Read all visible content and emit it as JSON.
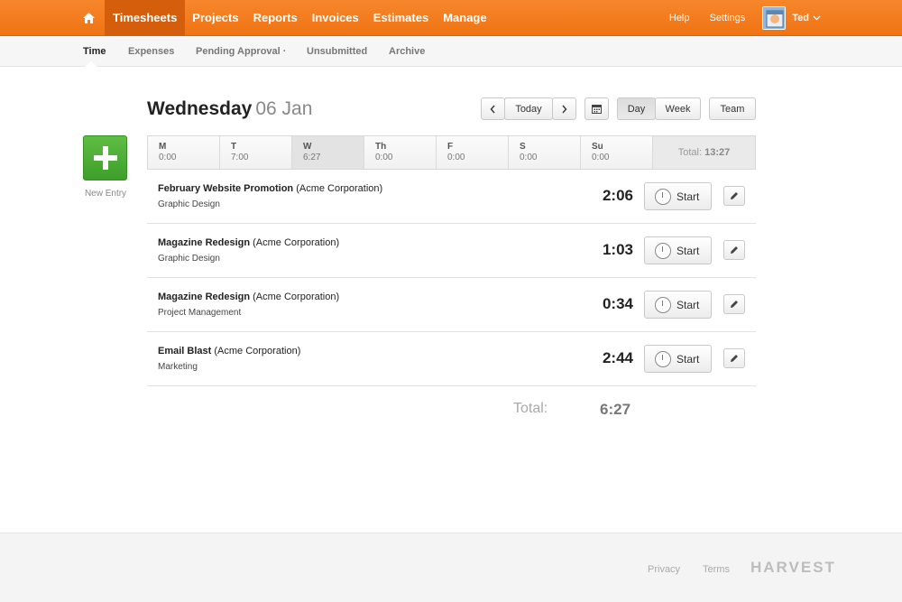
{
  "nav": {
    "items": [
      {
        "label": "Timesheets",
        "active": true
      },
      {
        "label": "Projects"
      },
      {
        "label": "Reports"
      },
      {
        "label": "Invoices"
      },
      {
        "label": "Estimates"
      },
      {
        "label": "Manage"
      }
    ],
    "help": "Help",
    "settings": "Settings",
    "user": "Ted",
    "home_icon": "home-icon",
    "accent_color": "#f47c20"
  },
  "subnav": {
    "items": [
      {
        "label": "Time",
        "active": true
      },
      {
        "label": "Expenses"
      },
      {
        "label": "Pending Approval ·"
      },
      {
        "label": "Unsubmitted"
      },
      {
        "label": "Archive"
      }
    ]
  },
  "new_entry": {
    "label": "New Entry",
    "color": "#4aab33"
  },
  "heading": {
    "day": "Wednesday",
    "date": "06 Jan"
  },
  "controls": {
    "prev": "‹",
    "today": "Today",
    "next": "›",
    "day": "Day",
    "week": "Week",
    "team": "Team"
  },
  "week": {
    "days": [
      {
        "d": "M",
        "h": "0:00"
      },
      {
        "d": "T",
        "h": "7:00"
      },
      {
        "d": "W",
        "h": "6:27",
        "active": true
      },
      {
        "d": "Th",
        "h": "0:00"
      },
      {
        "d": "F",
        "h": "0:00"
      },
      {
        "d": "S",
        "h": "0:00"
      },
      {
        "d": "Su",
        "h": "0:00"
      }
    ],
    "total_label": "Total:",
    "total_value": "13:27"
  },
  "entries": [
    {
      "project": "February Website Promotion",
      "client": "(Acme Corporation)",
      "task": "Graphic Design",
      "hours": "2:06"
    },
    {
      "project": "Magazine Redesign",
      "client": "(Acme Corporation)",
      "task": "Graphic Design",
      "hours": "1:03"
    },
    {
      "project": "Magazine Redesign",
      "client": "(Acme Corporation)",
      "task": "Project Management",
      "hours": "0:34"
    },
    {
      "project": "Email Blast",
      "client": "(Acme Corporation)",
      "task": "Marketing",
      "hours": "2:44"
    }
  ],
  "start_label": "Start",
  "total": {
    "label": "Total:",
    "value": "6:27"
  },
  "footer": {
    "privacy": "Privacy",
    "terms": "Terms",
    "brand": "HARVEST"
  }
}
